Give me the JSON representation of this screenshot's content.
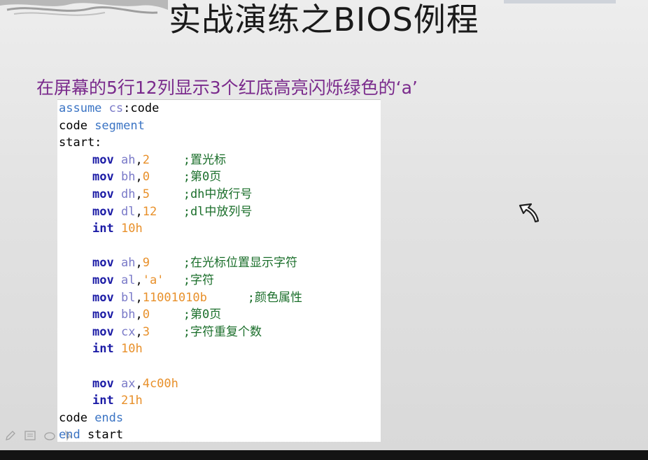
{
  "slide": {
    "title": "实战演练之BIOS例程",
    "subtitle": "在屏幕的5行12列显示3个红底高亮闪烁绿色的‘a’"
  },
  "code": {
    "line1": {
      "k1": "assume",
      "k2": "cs",
      "t": ":code"
    },
    "line2": {
      "t": "code ",
      "k": "segment"
    },
    "line3": {
      "t": "start:"
    },
    "line4": {
      "op": "mov",
      "reg": "ah",
      "sep": ",",
      "val": "2",
      "cmt": ";置光标"
    },
    "line5": {
      "op": "mov",
      "reg": "bh",
      "sep": ",",
      "val": "0",
      "cmt": ";第0页"
    },
    "line6": {
      "op": "mov",
      "reg": "dh",
      "sep": ",",
      "val": "5",
      "cmt": ";dh中放行号"
    },
    "line7": {
      "op": "mov",
      "reg": "dl",
      "sep": ",",
      "val": "12",
      "cmt": ";dl中放列号"
    },
    "line8": {
      "op": "int",
      "val": "10h"
    },
    "line9": {
      "op": "mov",
      "reg": "ah",
      "sep": ",",
      "val": "9",
      "cmt": ";在光标位置显示字符"
    },
    "line10": {
      "op": "mov",
      "reg": "al",
      "sep": ",",
      "val": "'a'",
      "cmt": ";字符"
    },
    "line11": {
      "op": "mov",
      "reg": "bl",
      "sep": ",",
      "val": "11001010b",
      "cmt": ";颜色属性"
    },
    "line12": {
      "op": "mov",
      "reg": "bh",
      "sep": ",",
      "val": "0",
      "cmt": ";第0页"
    },
    "line13": {
      "op": "mov",
      "reg": "cx",
      "sep": ",",
      "val": "3",
      "cmt": ";字符重复个数"
    },
    "line14": {
      "op": "int",
      "val": "10h"
    },
    "line15": {
      "op": "mov",
      "reg": "ax",
      "sep": ",",
      "val": "4c00h"
    },
    "line16": {
      "op": "int",
      "val": "21h"
    },
    "line17": {
      "t": "code ",
      "k": "ends"
    },
    "line18": {
      "k": "end",
      "t": " start"
    }
  },
  "icons": {
    "cursor": "arrow-cursor-icon",
    "pen": "pen-icon",
    "menu": "slide-menu-icon",
    "eraser": "eraser-icon",
    "pointer": "pointer-icon"
  },
  "colors": {
    "subtitle": "#7a2a8c",
    "keyword": "#3b74c4",
    "instruction": "#1c1ca6",
    "register": "#7a7ac8",
    "number": "#e8902a",
    "comment": "#1a6e2a"
  }
}
